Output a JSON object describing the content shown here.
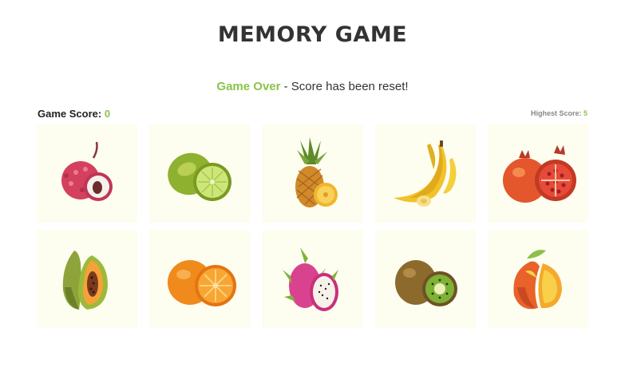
{
  "game": {
    "title": "MEMORY GAME",
    "status_highlight": "Game Over",
    "status_rest": " - Score has been reset!"
  },
  "scores": {
    "game_label": "Game Score: ",
    "game_value": "0",
    "high_label": "Highest Score: ",
    "high_value": "5"
  },
  "colors": {
    "accent": "#8bc34a",
    "card_bg": "#fdfdf0",
    "title": "#333333"
  },
  "cards": [
    {
      "fruit": "lychee-icon"
    },
    {
      "fruit": "lime-icon"
    },
    {
      "fruit": "pineapple-icon"
    },
    {
      "fruit": "banana-icon"
    },
    {
      "fruit": "pomegranate-icon"
    },
    {
      "fruit": "papaya-icon"
    },
    {
      "fruit": "orange-icon"
    },
    {
      "fruit": "dragonfruit-icon"
    },
    {
      "fruit": "kiwi-icon"
    },
    {
      "fruit": "mango-icon"
    }
  ]
}
